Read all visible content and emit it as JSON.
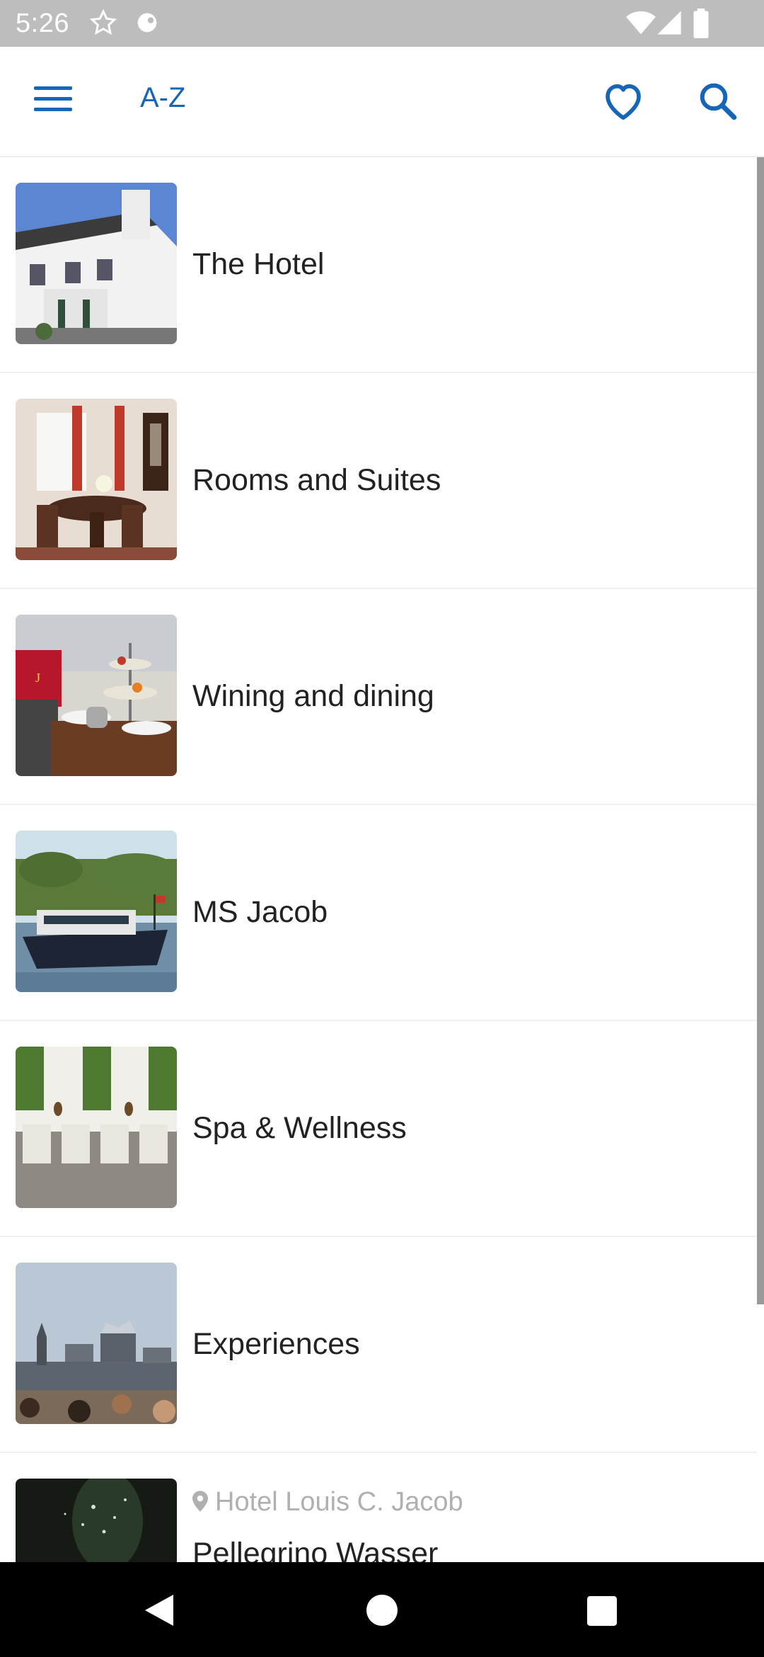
{
  "status_bar": {
    "time": "5:26",
    "icons": [
      "star-icon",
      "notification-icon",
      "wifi-icon",
      "signal-icon",
      "battery-icon"
    ]
  },
  "app_bar": {
    "title": "A-Z",
    "menu_icon": "hamburger-menu-icon",
    "favorites_icon": "heart-icon",
    "search_icon": "search-icon",
    "accent_color": "#1565b8"
  },
  "items": [
    {
      "label": "The Hotel",
      "image": "hotel-building-photo"
    },
    {
      "label": "Rooms and Suites",
      "image": "suite-interior-photo"
    },
    {
      "label": "Wining and dining",
      "image": "afternoon-tea-photo"
    },
    {
      "label": "MS Jacob",
      "image": "river-boat-photo"
    },
    {
      "label": "Spa & Wellness",
      "image": "spa-loungers-photo"
    },
    {
      "label": "Experiences",
      "image": "harbor-skyline-photo"
    },
    {
      "location": "Hotel Louis C. Jacob",
      "label": "Pellegrino Wasser",
      "image": "water-splash-photo",
      "location_icon": "location-pin-icon"
    }
  ],
  "nav_bar": {
    "icons": [
      "back-icon",
      "home-icon",
      "recents-icon"
    ]
  }
}
